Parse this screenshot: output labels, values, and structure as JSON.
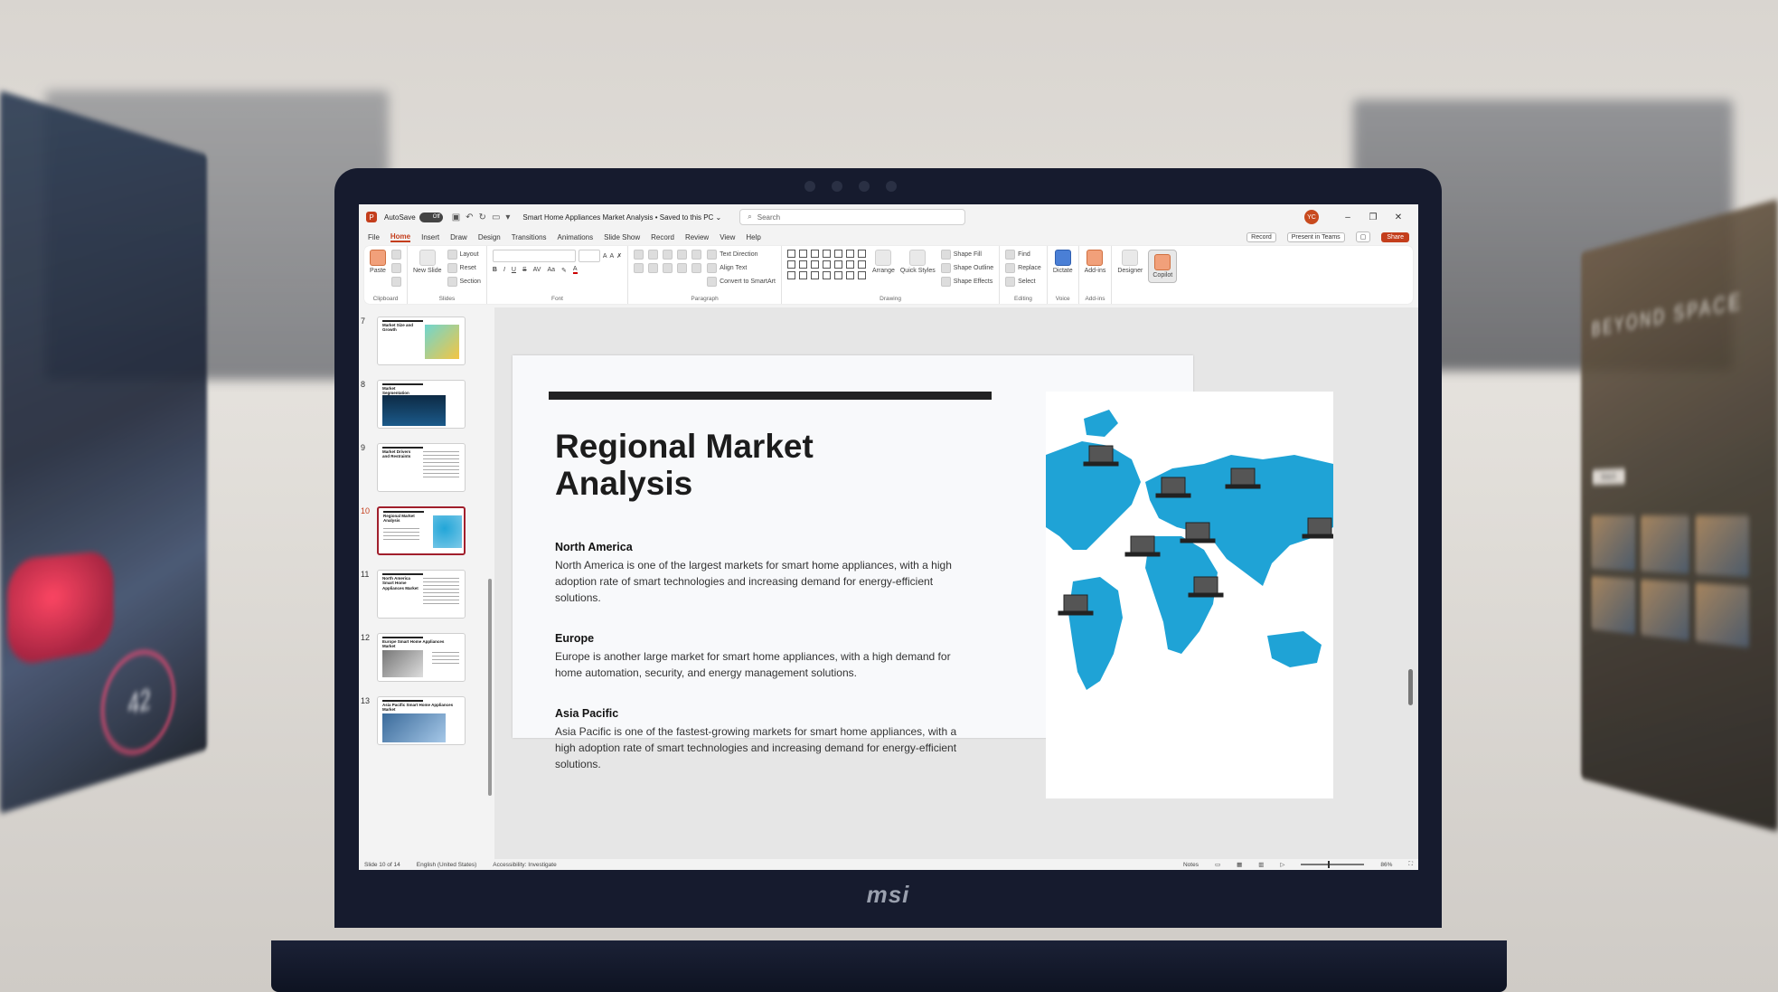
{
  "background": {
    "left_speed": "42",
    "right_brand": "BEYOND SPACE",
    "right_button": "Watch"
  },
  "laptop": {
    "brand": "msi"
  },
  "titlebar": {
    "app_icon": "P",
    "autosave_label": "AutoSave",
    "autosave_state": "Off",
    "doc_title": "Smart Home Appliances Market Analysis • Saved to this PC ⌄",
    "search_placeholder": "Search",
    "avatar_initials": "YC"
  },
  "menu": {
    "tabs": [
      "File",
      "Home",
      "Insert",
      "Draw",
      "Design",
      "Transitions",
      "Animations",
      "Slide Show",
      "Record",
      "Review",
      "View",
      "Help"
    ],
    "active_tab": "Home",
    "record": "Record",
    "present_in_teams": "Present in Teams",
    "share": "Share"
  },
  "ribbon": {
    "clipboard": {
      "label": "Clipboard",
      "paste": "Paste"
    },
    "slides": {
      "label": "Slides",
      "new_slide": "New Slide",
      "layout": "Layout",
      "reset": "Reset",
      "section": "Section"
    },
    "font": {
      "label": "Font"
    },
    "paragraph": {
      "label": "Paragraph",
      "text_direction": "Text Direction",
      "align_text": "Align Text",
      "convert_smartart": "Convert to SmartArt"
    },
    "drawing": {
      "label": "Drawing",
      "arrange": "Arrange",
      "quick_styles": "Quick Styles",
      "shape_fill": "Shape Fill",
      "shape_outline": "Shape Outline",
      "shape_effects": "Shape Effects"
    },
    "editing": {
      "label": "Editing",
      "find": "Find",
      "replace": "Replace",
      "select": "Select"
    },
    "voice": {
      "label": "Voice",
      "dictate": "Dictate"
    },
    "addins": {
      "label": "Add-ins",
      "addins": "Add-ins"
    },
    "designer": "Designer",
    "copilot": "Copilot"
  },
  "thumbnails": [
    {
      "num": "7",
      "title": "Market Size and Growth"
    },
    {
      "num": "8",
      "title": "Market Segmentation"
    },
    {
      "num": "9",
      "title": "Market Drivers and Restraints"
    },
    {
      "num": "10",
      "title": "Regional Market Analysis"
    },
    {
      "num": "11",
      "title": "North America Smart Home Appliances Market"
    },
    {
      "num": "12",
      "title": "Europe Smart Home Appliances Market"
    },
    {
      "num": "13",
      "title": "Asia Pacific Smart Home Appliances Market"
    }
  ],
  "slide": {
    "title": "Regional Market Analysis",
    "sections": [
      {
        "heading": "North America",
        "body": "North America is one of the largest markets for smart home appliances, with a high adoption rate of smart technologies and increasing demand for energy-efficient solutions."
      },
      {
        "heading": "Europe",
        "body": "Europe is another large market for smart home appliances, with a high demand for home automation, security, and energy management solutions."
      },
      {
        "heading": "Asia Pacific",
        "body": "Asia Pacific is one of the fastest-growing markets for smart home appliances, with a high adoption rate of smart technologies and increasing demand for energy-efficient solutions."
      }
    ],
    "map_color": "#1fa3d6"
  },
  "statusbar": {
    "slide_count": "Slide 10 of 14",
    "language": "English (United States)",
    "accessibility": "Accessibility: Investigate",
    "notes": "Notes",
    "zoom": "86%"
  }
}
